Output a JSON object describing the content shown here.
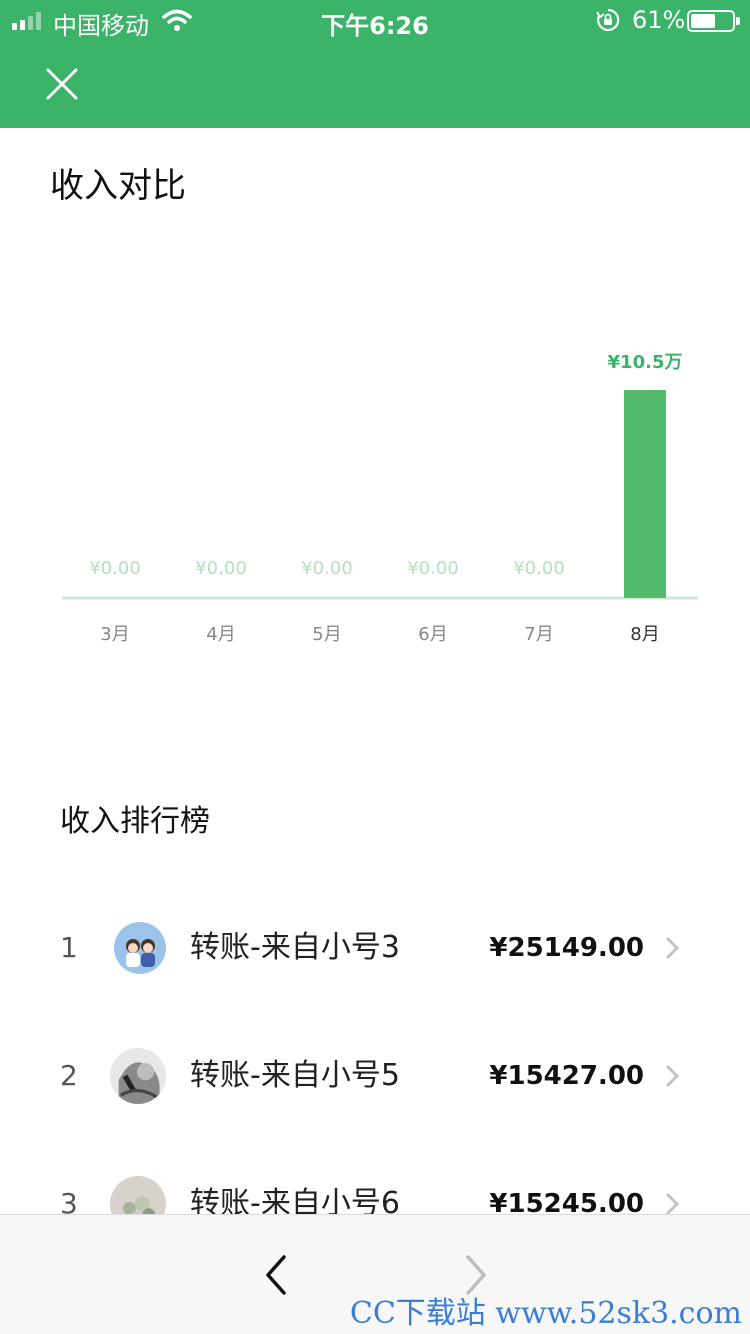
{
  "status_bar": {
    "carrier": "中国移动",
    "time": "下午6:26",
    "battery_pct": "61%",
    "battery_level": 0.61
  },
  "header": {
    "close_icon": "close-icon"
  },
  "title": "收入对比",
  "chart_data": {
    "type": "bar",
    "categories": [
      "3月",
      "4月",
      "5月",
      "6月",
      "7月",
      "8月"
    ],
    "values": [
      0,
      0,
      0,
      0,
      0,
      105000
    ],
    "value_labels": [
      "¥0.00",
      "¥0.00",
      "¥0.00",
      "¥0.00",
      "¥0.00",
      "¥10.5万"
    ],
    "title": "",
    "xlabel": "",
    "ylabel": "",
    "ylim": [
      0,
      105000
    ],
    "grid": false,
    "colors": {
      "bar": "#52bc6c",
      "active_label": "#3bb46a",
      "inactive_label": "#b5dfc0",
      "baseline": "#cbead3",
      "tick": "#888888",
      "active_tick": "#333333"
    }
  },
  "ranking": {
    "title": "收入排行榜",
    "items": [
      {
        "rank": "1",
        "name": "转账-来自小号3",
        "amount": "¥25149.00",
        "avatar": "cartoon-couple-avatar"
      },
      {
        "rank": "2",
        "name": "转账-来自小号5",
        "amount": "¥15427.00",
        "avatar": "monochrome-photo-avatar"
      },
      {
        "rank": "3",
        "name": "转账-来自小号6",
        "amount": "¥15245.00",
        "avatar": "flower-photo-avatar"
      }
    ]
  },
  "bottom_nav": {
    "back_icon": "chevron-left-icon",
    "forward_icon": "chevron-right-icon"
  },
  "watermark": "CC下载站 www.52sk3.com",
  "colors": {
    "brand_green": "#3bb46a"
  }
}
